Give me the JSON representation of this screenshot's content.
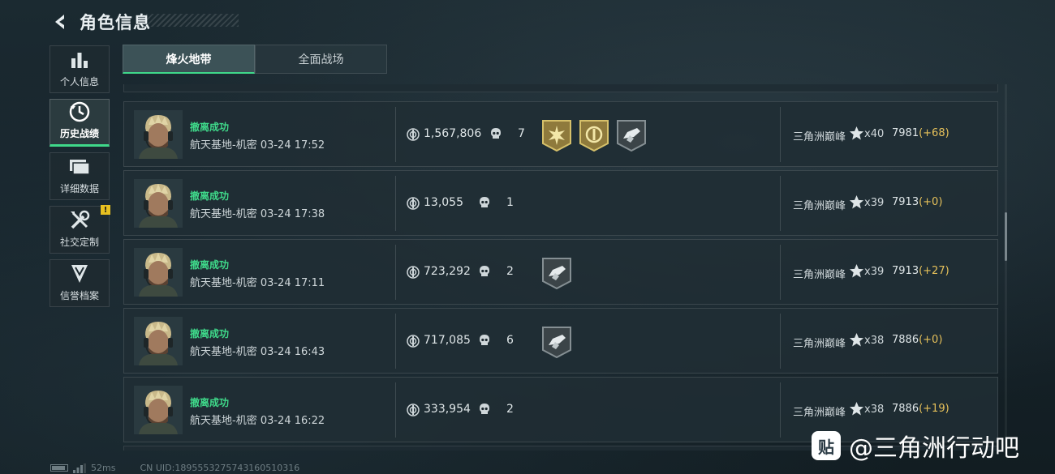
{
  "header": {
    "title": "角色信息",
    "back_icon": "back-arrow-icon"
  },
  "sidebar": {
    "items": [
      {
        "label": "个人信息",
        "icon": "bar-chart-icon",
        "active": false
      },
      {
        "label": "历史战绩",
        "icon": "clock-history-icon",
        "active": true
      },
      {
        "label": "详细数据",
        "icon": "folder-stack-icon",
        "active": false
      },
      {
        "label": "社交定制",
        "icon": "tools-icon",
        "active": false,
        "alert": "!"
      },
      {
        "label": "信誉档案",
        "icon": "shield-chevron-icon",
        "active": false
      }
    ]
  },
  "tabs": [
    {
      "label": "烽火地带",
      "active": true
    },
    {
      "label": "全面战场",
      "active": false
    }
  ],
  "matches": [
    {
      "status": "撤离成功",
      "map_time": "航天基地-机密 03-24 17:52",
      "assets": "1,567,806",
      "kills": "7",
      "badges": [
        "gold-starburst-badge",
        "gold-coin-badge",
        "gray-weapon-badge"
      ],
      "rank_name": "三角洲巅峰",
      "stars": "x40",
      "score": "7981",
      "delta": "(+68)"
    },
    {
      "status": "撤离成功",
      "map_time": "航天基地-机密 03-24 17:38",
      "assets": "13,055",
      "kills": "1",
      "badges": [],
      "rank_name": "三角洲巅峰",
      "stars": "x39",
      "score": "7913",
      "delta": "(+0)"
    },
    {
      "status": "撤离成功",
      "map_time": "航天基地-机密 03-24 17:11",
      "assets": "723,292",
      "kills": "2",
      "badges": [
        "gray-weapon-badge"
      ],
      "rank_name": "三角洲巅峰",
      "stars": "x39",
      "score": "7913",
      "delta": "(+27)"
    },
    {
      "status": "撤离成功",
      "map_time": "航天基地-机密 03-24 16:43",
      "assets": "717,085",
      "kills": "6",
      "badges": [
        "gray-weapon-badge"
      ],
      "rank_name": "三角洲巅峰",
      "stars": "x38",
      "score": "7886",
      "delta": "(+0)"
    },
    {
      "status": "撤离成功",
      "map_time": "航天基地-机密 03-24 16:22",
      "assets": "333,954",
      "kills": "2",
      "badges": [],
      "rank_name": "三角洲巅峰",
      "stars": "x38",
      "score": "7886",
      "delta": "(+19)"
    }
  ],
  "footer": {
    "ping": "52ms",
    "uid": "CN UID:1895553275743160510316"
  },
  "watermark": {
    "logo": "贴",
    "text": "@三角洲行动吧"
  },
  "colors": {
    "accent_green": "#3fd98a",
    "delta_gold": "#e6c15a",
    "alert_yellow": "#e8c020"
  }
}
